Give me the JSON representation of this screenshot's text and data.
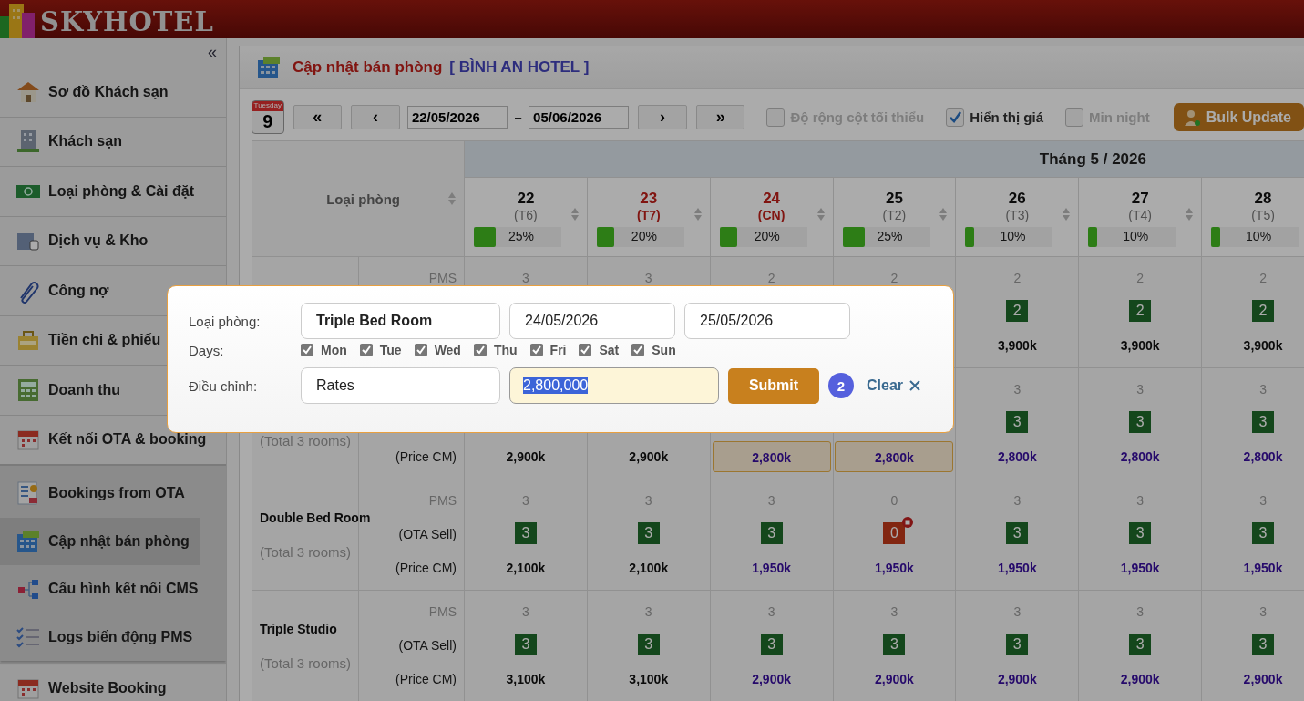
{
  "app": {
    "logo": "SKYHOTEL",
    "collapse": "«"
  },
  "sidebar": {
    "items": [
      {
        "label": "Sơ đồ Khách sạn",
        "selected": false
      },
      {
        "label": "Khách sạn",
        "selected": false
      },
      {
        "label": "Loại phòng & Cài đặt",
        "selected": false
      },
      {
        "label": "Dịch vụ & Kho",
        "selected": false
      },
      {
        "label": "Công nợ",
        "selected": false
      },
      {
        "label": "Tiền chi & phiếu",
        "selected": false
      },
      {
        "label": "Doanh thu",
        "selected": false
      },
      {
        "label": "Kết nối OTA & booking",
        "selected": false,
        "expanded": true,
        "children": [
          {
            "label": "Bookings from OTA",
            "selected": false
          },
          {
            "label": "Cập nhật bán phòng",
            "selected": true
          },
          {
            "label": "Cấu hình kết nối CMS",
            "selected": false
          },
          {
            "label": "Logs biến động PMS",
            "selected": false
          }
        ]
      },
      {
        "label": "Website Booking",
        "selected": false
      }
    ]
  },
  "page": {
    "title": "Cập nhật bán phòng",
    "hotel": "[ BÌNH AN HOTEL ]"
  },
  "toolbar": {
    "calendar_weekday": "Tuesday",
    "calendar_day": "9",
    "first": "«",
    "prev": "‹",
    "date_from": "22/05/2026",
    "separator": "–",
    "date_to": "05/06/2026",
    "next": "›",
    "last": "»",
    "options": [
      {
        "label": "Độ rộng cột tối thiểu",
        "checked": false
      },
      {
        "label": "Hiển thị giá",
        "checked": true
      },
      {
        "label": "Min night",
        "checked": false
      }
    ],
    "bulk_update": "Bulk Update"
  },
  "table": {
    "room_column": "Loại phòng",
    "month": "Tháng 5 / 2026",
    "days": [
      {
        "day": "22",
        "weekday": "(T6)",
        "weekend": false,
        "occupancy": "25%",
        "level": 0.25
      },
      {
        "day": "23",
        "weekday": "(T7)",
        "weekend": true,
        "occupancy": "20%",
        "level": 0.2
      },
      {
        "day": "24",
        "weekday": "(CN)",
        "weekend": true,
        "occupancy": "20%",
        "level": 0.2
      },
      {
        "day": "25",
        "weekday": "(T2)",
        "weekend": false,
        "occupancy": "25%",
        "level": 0.25
      },
      {
        "day": "26",
        "weekday": "(T3)",
        "weekend": false,
        "occupancy": "10%",
        "level": 0.1
      },
      {
        "day": "27",
        "weekday": "(T4)",
        "weekend": false,
        "occupancy": "10%",
        "level": 0.1
      },
      {
        "day": "28",
        "weekday": "(T5)",
        "weekend": false,
        "occupancy": "10%",
        "level": 0.1
      }
    ],
    "rows": [
      {
        "sub_labels": {
          "pms": "PMS"
        },
        "cells": [
          {
            "pms": "3"
          },
          {
            "pms": "3"
          },
          {
            "pms": "2"
          },
          {
            "pms": "2"
          },
          {
            "pms": "2",
            "ota": "2",
            "stop_sell": false,
            "price": "3,900k",
            "changed": false,
            "highlight": false
          },
          {
            "pms": "2",
            "ota": "2",
            "stop_sell": false,
            "price": "3,900k",
            "changed": false,
            "highlight": false
          },
          {
            "pms": "2",
            "ota": "2",
            "stop_sell": false,
            "price": "3,900k",
            "changed": false,
            "highlight": false
          }
        ]
      },
      {
        "total": "(Total 3 rooms)",
        "sub_labels": {
          "price": "(Price CM)"
        },
        "cells": [
          {
            "price": "2,900k",
            "changed": false,
            "highlight": false
          },
          {
            "price": "2,900k",
            "changed": false,
            "highlight": false
          },
          {
            "price": "2,800k",
            "changed": true,
            "highlight": true
          },
          {
            "price": "2,800k",
            "changed": true,
            "highlight": true
          },
          {
            "pms": "3",
            "ota": "3",
            "stop_sell": false,
            "price": "2,800k",
            "changed": true,
            "highlight": false
          },
          {
            "pms": "3",
            "ota": "3",
            "stop_sell": false,
            "price": "2,800k",
            "changed": true,
            "highlight": false
          },
          {
            "pms": "3",
            "ota": "3",
            "stop_sell": false,
            "price": "2,800k",
            "changed": true,
            "highlight": false
          }
        ]
      },
      {
        "name": "Double Bed Room",
        "total": "(Total 3 rooms)",
        "sub_labels": {
          "pms": "PMS",
          "ota": "(OTA Sell)",
          "price": "(Price CM)"
        },
        "cells": [
          {
            "pms": "3",
            "ota": "3",
            "stop_sell": false,
            "price": "2,100k",
            "changed": false,
            "highlight": false
          },
          {
            "pms": "3",
            "ota": "3",
            "stop_sell": false,
            "price": "2,100k",
            "changed": false,
            "highlight": false
          },
          {
            "pms": "3",
            "ota": "3",
            "stop_sell": false,
            "price": "1,950k",
            "changed": true,
            "highlight": false
          },
          {
            "pms": "0",
            "ota": "0",
            "stop_sell": true,
            "price": "1,950k",
            "changed": true,
            "highlight": false
          },
          {
            "pms": "3",
            "ota": "3",
            "stop_sell": false,
            "price": "1,950k",
            "changed": true,
            "highlight": false
          },
          {
            "pms": "3",
            "ota": "3",
            "stop_sell": false,
            "price": "1,950k",
            "changed": true,
            "highlight": false
          },
          {
            "pms": "3",
            "ota": "3",
            "stop_sell": false,
            "price": "1,950k",
            "changed": true,
            "highlight": false
          }
        ]
      },
      {
        "name": "Triple Studio",
        "total": "(Total 3 rooms)",
        "sub_labels": {
          "pms": "PMS",
          "ota": "(OTA Sell)",
          "price": "(Price CM)"
        },
        "cells": [
          {
            "pms": "3",
            "ota": "3",
            "stop_sell": false,
            "price": "3,100k",
            "changed": false,
            "highlight": false
          },
          {
            "pms": "3",
            "ota": "3",
            "stop_sell": false,
            "price": "3,100k",
            "changed": false,
            "highlight": false
          },
          {
            "pms": "3",
            "ota": "3",
            "stop_sell": false,
            "price": "2,900k",
            "changed": true,
            "highlight": false
          },
          {
            "pms": "3",
            "ota": "3",
            "stop_sell": false,
            "price": "2,900k",
            "changed": true,
            "highlight": false
          },
          {
            "pms": "3",
            "ota": "3",
            "stop_sell": false,
            "price": "2,900k",
            "changed": true,
            "highlight": false
          },
          {
            "pms": "3",
            "ota": "3",
            "stop_sell": false,
            "price": "2,900k",
            "changed": true,
            "highlight": false
          },
          {
            "pms": "3",
            "ota": "3",
            "stop_sell": false,
            "price": "2,900k",
            "changed": true,
            "highlight": false
          }
        ]
      }
    ]
  },
  "dialog": {
    "room_label": "Loại phòng:",
    "room_type": "Triple Bed Room",
    "from": "24/05/2026",
    "to": "25/05/2026",
    "days_label": "Days:",
    "days": [
      {
        "label": "Mon",
        "checked": true
      },
      {
        "label": "Tue",
        "checked": true
      },
      {
        "label": "Wed",
        "checked": true
      },
      {
        "label": "Thu",
        "checked": true
      },
      {
        "label": "Fri",
        "checked": true
      },
      {
        "label": "Sat",
        "checked": true
      },
      {
        "label": "Sun",
        "checked": true
      }
    ],
    "adjust_label": "Điều chỉnh:",
    "adjust_type": "Rates",
    "value": "2,800,000",
    "submit": "Submit",
    "count": "2",
    "clear": "Clear"
  }
}
